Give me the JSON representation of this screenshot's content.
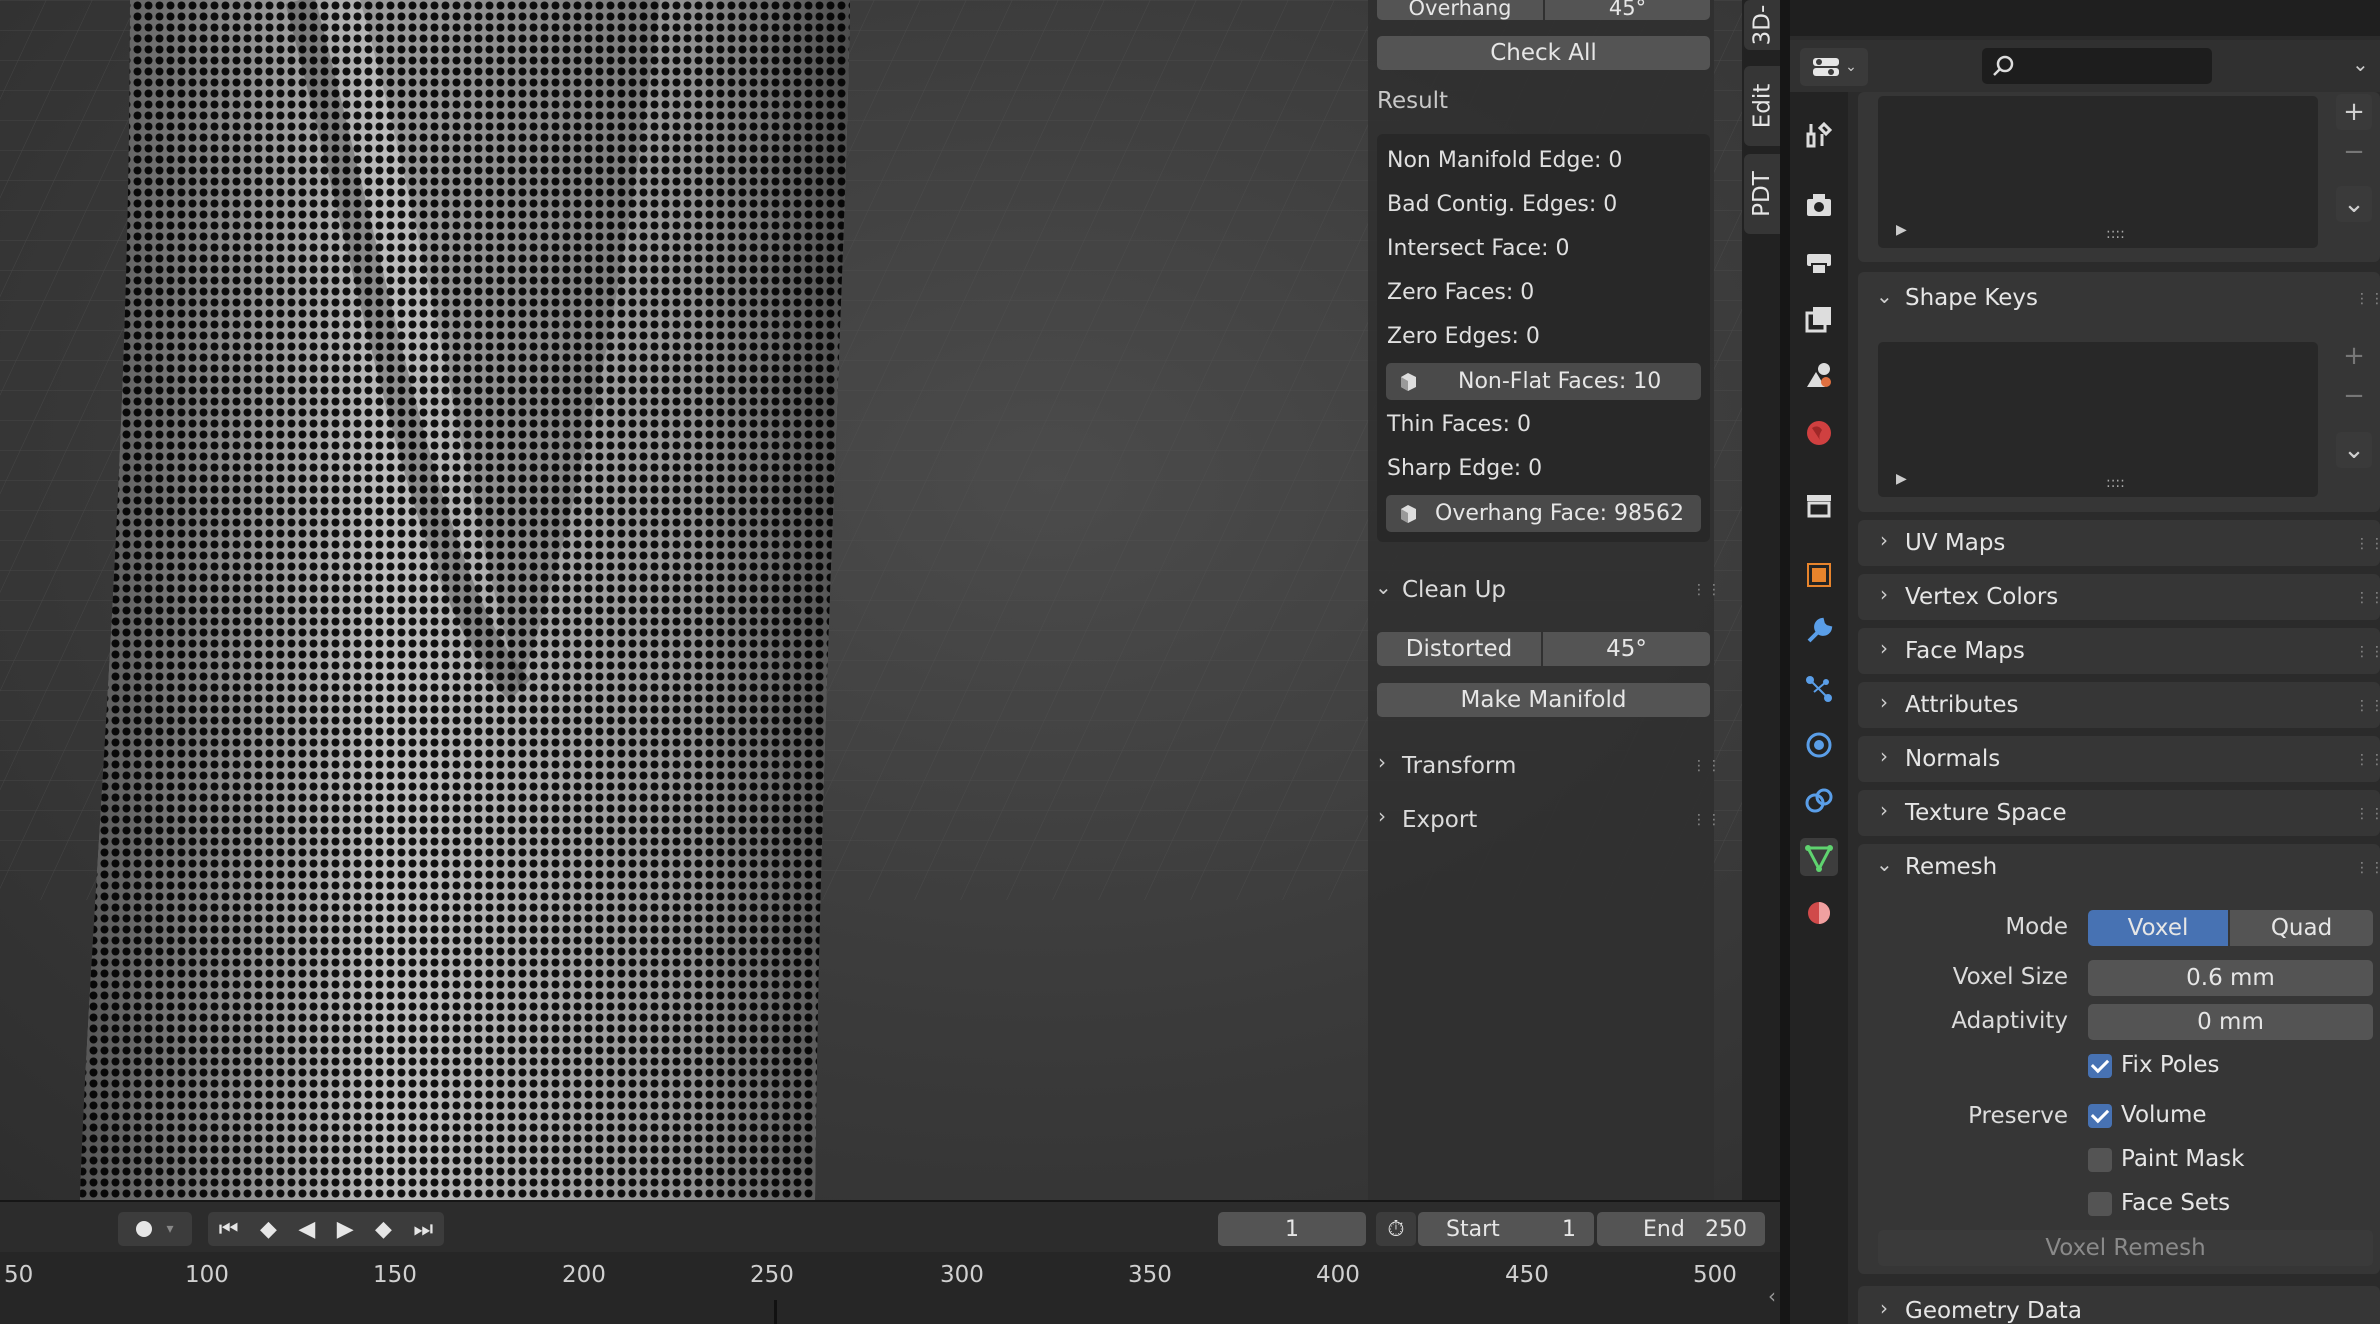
{
  "n_panel": {
    "overhang_label": "Overhang",
    "overhang_value": "45°",
    "check_all": "Check All",
    "result_label": "Result",
    "results": {
      "non_manifold": "Non Manifold Edge: 0",
      "bad_contig": "Bad Contig. Edges: 0",
      "intersect": "Intersect Face: 0",
      "zero_faces": "Zero Faces: 0",
      "zero_edges": "Zero Edges: 0",
      "non_flat": "Non-Flat Faces: 10",
      "thin_faces": "Thin Faces: 0",
      "sharp_edge": "Sharp Edge: 0",
      "overhang_face": "Overhang Face: 98562"
    },
    "clean_up": "Clean Up",
    "distorted": "Distorted",
    "distorted_value": "45°",
    "make_manifold": "Make Manifold",
    "transform": "Transform",
    "export": "Export"
  },
  "vertical_tabs": {
    "tab1": "3D-",
    "tab2": "Edit",
    "tab3": "PDT"
  },
  "timeline": {
    "current_frame": "1",
    "start_label": "Start",
    "start_value": "1",
    "end_label": "End",
    "end_value": "250",
    "ticks": [
      "50",
      "100",
      "150",
      "200",
      "250",
      "300",
      "350",
      "400",
      "450",
      "500"
    ]
  },
  "properties": {
    "search_placeholder": "",
    "shape_keys": "Shape Keys",
    "uv_maps": "UV Maps",
    "vertex_colors": "Vertex Colors",
    "face_maps": "Face Maps",
    "attributes": "Attributes",
    "normals": "Normals",
    "texture_space": "Texture Space",
    "remesh": {
      "title": "Remesh",
      "mode_label": "Mode",
      "mode_voxel": "Voxel",
      "mode_quad": "Quad",
      "voxel_size_label": "Voxel Size",
      "voxel_size": "0.6 mm",
      "adaptivity_label": "Adaptivity",
      "adaptivity": "0 mm",
      "fix_poles": "Fix Poles",
      "preserve_label": "Preserve",
      "volume": "Volume",
      "paint_mask": "Paint Mask",
      "face_sets": "Face Sets",
      "voxel_remesh": "Voxel Remesh"
    },
    "geometry_data": "Geometry Data"
  },
  "colors": {
    "accent": "#4772b3",
    "active_tab_icon": "#5fd36f"
  }
}
